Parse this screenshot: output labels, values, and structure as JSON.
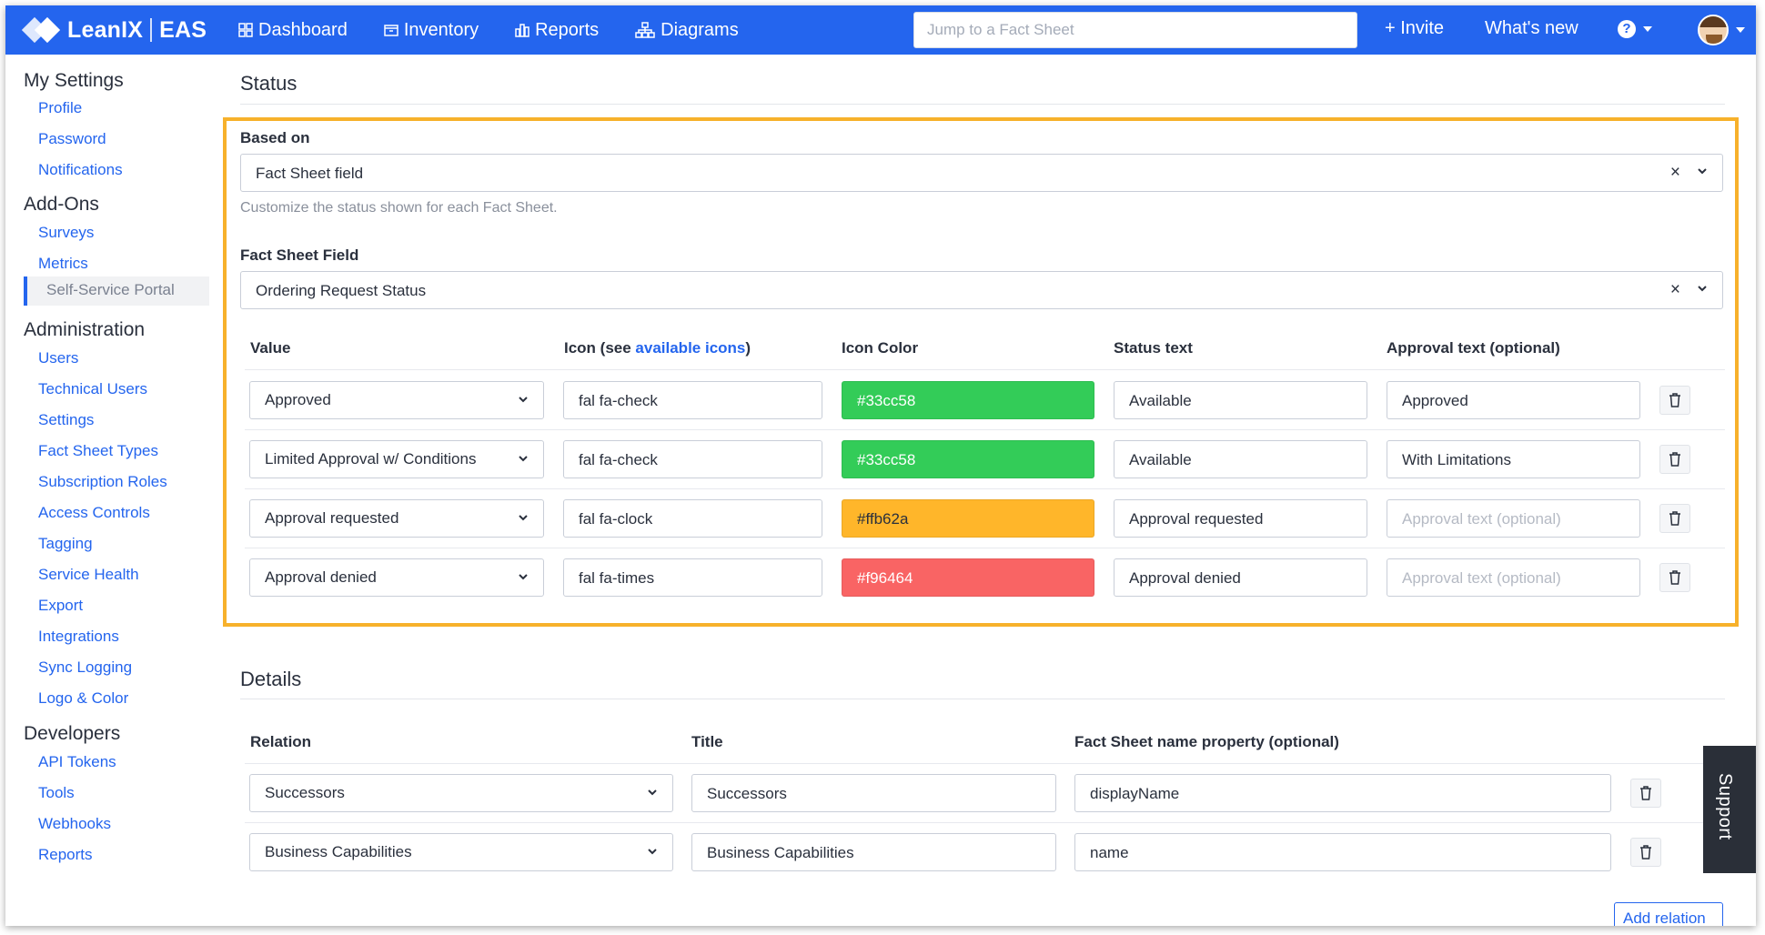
{
  "topbar": {
    "logo_name": "LeanIX",
    "workspace": "EAS",
    "nav": [
      {
        "label": "Dashboard",
        "icon": "dashboard-icon"
      },
      {
        "label": "Inventory",
        "icon": "inventory-icon"
      },
      {
        "label": "Reports",
        "icon": "reports-icon"
      },
      {
        "label": "Diagrams",
        "icon": "diagrams-icon"
      }
    ],
    "search_placeholder": "Jump to a Fact Sheet",
    "invite_label": "+ Invite",
    "whats_new_label": "What's new",
    "help_label": "?",
    "accent": "#2465ee"
  },
  "sidebar": {
    "sections": [
      {
        "title": "My Settings",
        "items": [
          "Profile",
          "Password",
          "Notifications"
        ]
      },
      {
        "title": "Add-Ons",
        "items": [
          "Surveys",
          "Metrics",
          "Self-Service Portal"
        ]
      },
      {
        "title": "Administration",
        "items": [
          "Users",
          "Technical Users",
          "Settings",
          "Fact Sheet Types",
          "Subscription Roles",
          "Access Controls",
          "Tagging",
          "Service Health",
          "Export",
          "Integrations",
          "Sync Logging",
          "Logo & Color"
        ]
      },
      {
        "title": "Developers",
        "items": [
          "API Tokens",
          "Tools",
          "Webhooks",
          "Reports"
        ]
      }
    ],
    "active_item": "Self-Service Portal"
  },
  "status": {
    "heading": "Status",
    "based_on_label": "Based on",
    "based_on_value": "Fact Sheet field",
    "hint": "Customize the status shown for each Fact Sheet.",
    "field_label": "Fact Sheet Field",
    "field_value": "Ordering Request Status",
    "columns": {
      "value": "Value",
      "icon_prefix": "Icon (see ",
      "icon_link": "available icons",
      "icon_suffix": ")",
      "icon_color": "Icon Color",
      "status_text": "Status text",
      "approval_text": "Approval text (optional)"
    },
    "approval_placeholder": "Approval text (optional)",
    "rows": [
      {
        "value": "Approved",
        "icon": "fal fa-check",
        "color": "#33cc58",
        "status_text": "Available",
        "approval_text": "Approved"
      },
      {
        "value": "Limited Approval w/ Conditions",
        "icon": "fal fa-check",
        "color": "#33cc58",
        "status_text": "Available",
        "approval_text": "With Limitations"
      },
      {
        "value": "Approval requested",
        "icon": "fal fa-clock",
        "color": "#ffb62a",
        "status_text": "Approval requested",
        "approval_text": ""
      },
      {
        "value": "Approval denied",
        "icon": "fal fa-times",
        "color": "#f96464",
        "status_text": "Approval denied",
        "approval_text": ""
      }
    ]
  },
  "details": {
    "heading": "Details",
    "columns": {
      "relation": "Relation",
      "title": "Title",
      "name_property": "Fact Sheet name property (optional)"
    },
    "rows": [
      {
        "relation": "Successors",
        "title": "Successors",
        "name_property": "displayName"
      },
      {
        "relation": "Business Capabilities",
        "title": "Business Capabilities",
        "name_property": "name"
      }
    ],
    "add_relation_label": "Add relation"
  },
  "support_label": "Support",
  "highlight_color": "#f7b12b"
}
